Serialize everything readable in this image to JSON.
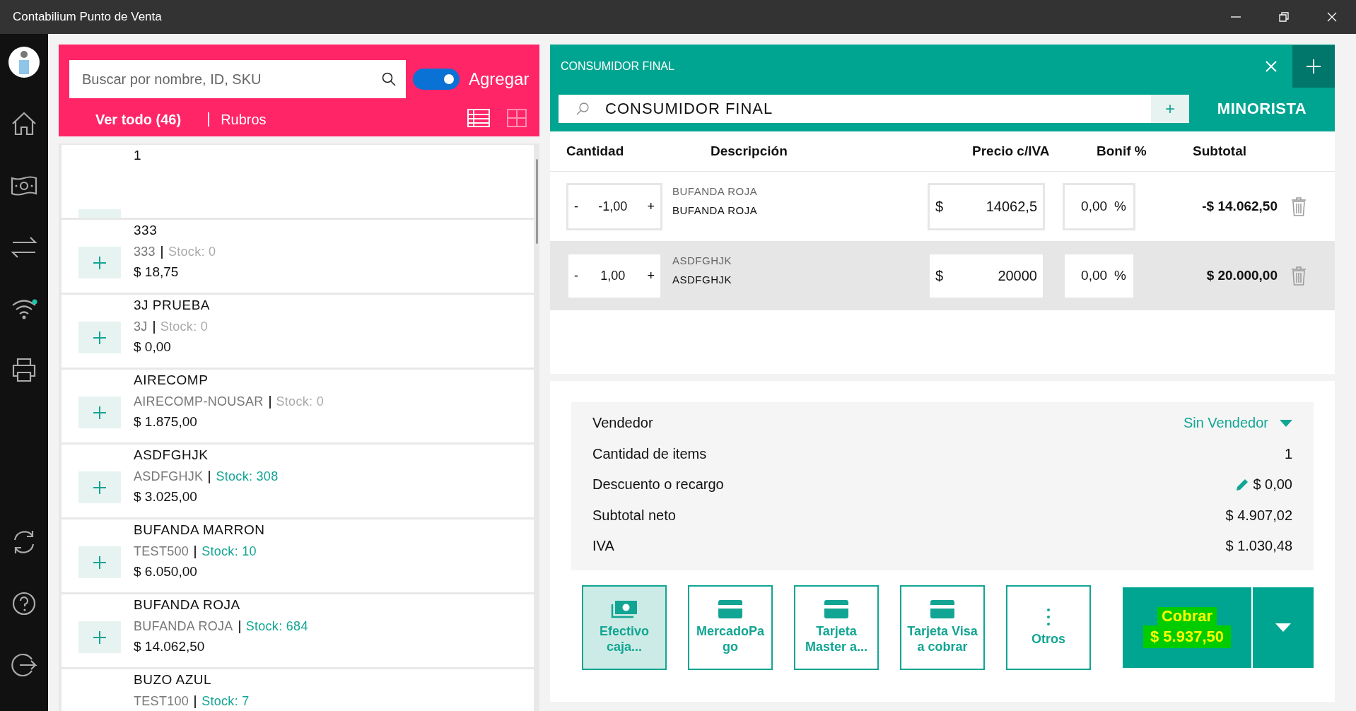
{
  "window": {
    "title": "Contabilium Punto de Venta"
  },
  "sidebar": {
    "items": [
      {
        "kind": "avatar"
      },
      {
        "kind": "home"
      },
      {
        "kind": "cash"
      },
      {
        "kind": "transfer"
      },
      {
        "kind": "wifi"
      },
      {
        "kind": "print"
      },
      {
        "kind": "sync"
      },
      {
        "kind": "help"
      },
      {
        "kind": "logout"
      }
    ]
  },
  "catalog": {
    "search": {
      "placeholder": "Buscar por nombre, ID, SKU"
    },
    "add_toggle": {
      "on": true,
      "label": "Agregar"
    },
    "filters": [
      {
        "label": "Ver todo (46)",
        "selected": true
      },
      {
        "label": "Rubros",
        "selected": false
      }
    ],
    "views": [
      {
        "kind": "list",
        "selected": true
      },
      {
        "kind": "grid",
        "selected": false
      }
    ],
    "products": [
      {
        "name": "1"
      },
      {
        "name": "333",
        "sku": "333",
        "stock": "Stock: 0",
        "in_stock": false,
        "price": "$ 18,75"
      },
      {
        "name": "3J PRUEBA",
        "sku": "3J",
        "stock": "Stock: 0",
        "in_stock": false,
        "price": "$ 0,00"
      },
      {
        "name": "AIRECOMP",
        "sku": "AIRECOMP-NOUSAR",
        "stock": "Stock: 0",
        "in_stock": false,
        "price": "$ 1.875,00"
      },
      {
        "name": "ASDFGHJK",
        "sku": "ASDFGHJK",
        "stock": "Stock: 308",
        "in_stock": true,
        "price": "$ 3.025,00"
      },
      {
        "name": "BUFANDA MARRON",
        "sku": "TEST500",
        "stock": "Stock: 10",
        "in_stock": true,
        "price": "$ 6.050,00"
      },
      {
        "name": "BUFANDA ROJA",
        "sku": "BUFANDA ROJA",
        "stock": "Stock: 684",
        "in_stock": true,
        "price": "$ 14.062,50"
      },
      {
        "name": "BUZO AZUL",
        "sku": "TEST100",
        "stock": "Stock: 7",
        "in_stock": true
      }
    ]
  },
  "sale": {
    "title": "CONSUMIDOR FINAL",
    "customer": {
      "value": "CONSUMIDOR FINAL",
      "add": "+"
    },
    "price_list": "MINORISTA",
    "columns": [
      "Cantidad",
      "Descripción",
      "Precio c/IVA",
      "Bonif %",
      "Subtotal"
    ],
    "rows": [
      {
        "selected": false,
        "minus": "-",
        "quantity": "-1,00",
        "plus": "+",
        "code": "BUFANDA ROJA",
        "description": "BUFANDA ROJA",
        "currency": "$",
        "price": "14062,5",
        "bonus": "0,00",
        "percent": "%",
        "subtotal": "-$ 14.062,50"
      },
      {
        "selected": true,
        "minus": "-",
        "quantity": "1,00",
        "plus": "+",
        "code": "ASDFGHJK",
        "description": "ASDFGHJK",
        "currency": "$",
        "price": "20000",
        "bonus": "0,00",
        "percent": "%",
        "subtotal": "$ 20.000,00"
      }
    ],
    "summary": [
      {
        "kind": "dropdown",
        "label": "Vendedor",
        "value": "Sin Vendedor"
      },
      {
        "kind": "plain",
        "label": "Cantidad de items",
        "value": "1"
      },
      {
        "kind": "editable",
        "label": "Descuento o recargo",
        "value": "$ 0,00"
      },
      {
        "kind": "plain",
        "label": "Subtotal neto",
        "value": "$ 4.907,02"
      },
      {
        "kind": "plain",
        "label": "IVA",
        "value": "$ 1.030,48"
      }
    ],
    "payments": [
      {
        "kind": "cash",
        "label": "Efectivo caja...",
        "selected": true
      },
      {
        "kind": "card",
        "label": "MercadoPa go",
        "selected": false
      },
      {
        "kind": "card",
        "label": "Tarjeta Master a...",
        "selected": false
      },
      {
        "kind": "card",
        "label": "Tarjeta Visa a cobrar",
        "selected": false
      },
      {
        "kind": "more",
        "label": "Otros",
        "selected": false
      }
    ],
    "charge": {
      "label": "Cobrar",
      "amount": "$ 5.937,50"
    }
  }
}
